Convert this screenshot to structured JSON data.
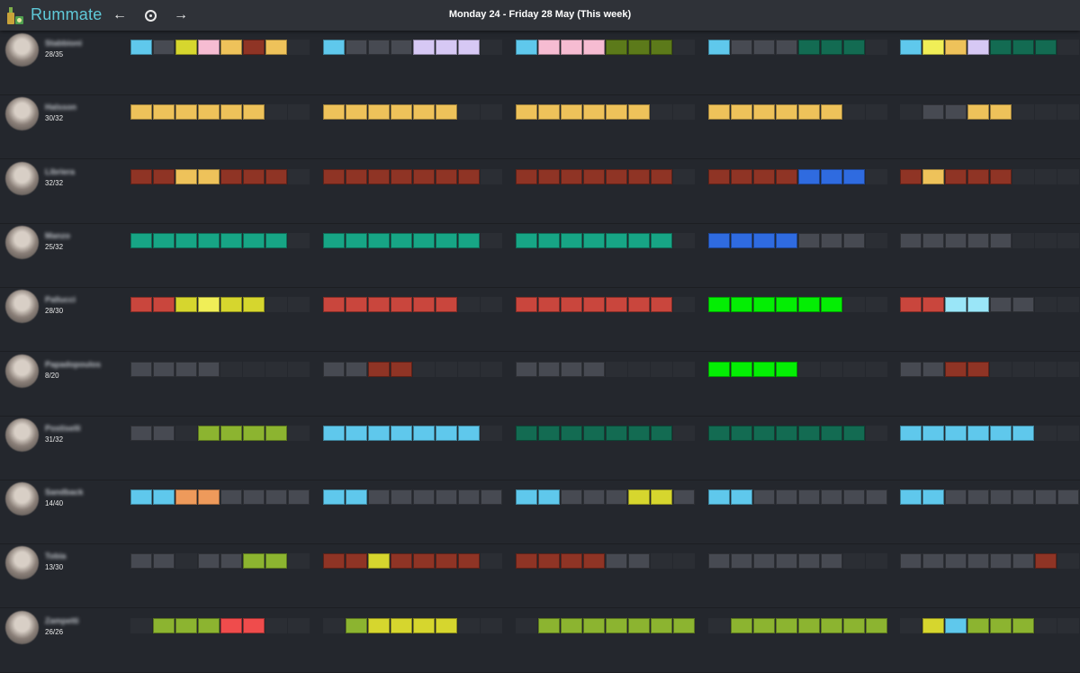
{
  "app": {
    "title": "Rummate"
  },
  "header": {
    "week_range": "Monday 24 - Friday 28 May (This week)"
  },
  "palette": {
    "e": "#2b2e34",
    "g": "#474a52",
    "c": "#5fc8ec",
    "y": "#d6d62e",
    "Y": "#f0ee57",
    "p": "#f6bcd2",
    "o": "#eec25a",
    "v": "#d6c8f4",
    "G": "#5c7a1a",
    "t": "#136b52",
    "r": "#8f3425",
    "b": "#2f6be0",
    "q": "#17a585",
    "R": "#c9463d",
    "L": "#04ee04",
    "l": "#8cb430",
    "a": "#ee9a5b",
    "s": "#ef4c4c",
    "k": "#9ae6f8"
  },
  "people": [
    {
      "name": "Stabbioni",
      "count": "28/35",
      "days": [
        "cgyporo",
        "cgggvvv",
        "cpppGGG",
        "cgggttt",
        "cYovttt"
      ]
    },
    {
      "name": "Halsson",
      "count": "30/32",
      "days": [
        "oooooo",
        "oooooo",
        "oooooo",
        "oooooo",
        "eggoo"
      ]
    },
    {
      "name": "Libriera",
      "count": "32/32",
      "days": [
        "rroorrr",
        "rrrrrrr",
        "rrrrrrr",
        "rrrrbbb",
        "rorrr"
      ]
    },
    {
      "name": "Manzo",
      "count": "25/32",
      "days": [
        "qqqqqqq",
        "qqqqqqq",
        "qqqqqqq",
        "bbbbggg",
        "ggggg"
      ]
    },
    {
      "name": "Pallucci",
      "count": "28/30",
      "days": [
        "RRyYyy",
        "RRRRRR",
        "RRRRRRR",
        "LLLLLL",
        "RRkkgg"
      ]
    },
    {
      "name": "Papadopoulos",
      "count": "8/20",
      "days": [
        "gggg",
        "ggrr",
        "gggg",
        "LLLL",
        "ggrr"
      ]
    },
    {
      "name": "Postiselli",
      "count": "31/32",
      "days": [
        "ggellll",
        "ccccccc",
        "ttttttt",
        "ttttttt",
        "cccccc"
      ]
    },
    {
      "name": "Sandback",
      "count": "14/40",
      "days": [
        "ccaaggggg",
        "ccgggggg",
        "ccgggyygg",
        "ccgggggg",
        "ccggggggg"
      ]
    },
    {
      "name": "Tobia",
      "count": "13/30",
      "days": [
        "ggeggll",
        "rryrrrr",
        "rrrrgg",
        "gggggg",
        "ggggggr"
      ]
    },
    {
      "name": "Zampetti",
      "count": "26/26",
      "days": [
        "elllss",
        "elyyyy",
        "elllllll",
        "elllllll",
        "eyclll"
      ]
    }
  ]
}
